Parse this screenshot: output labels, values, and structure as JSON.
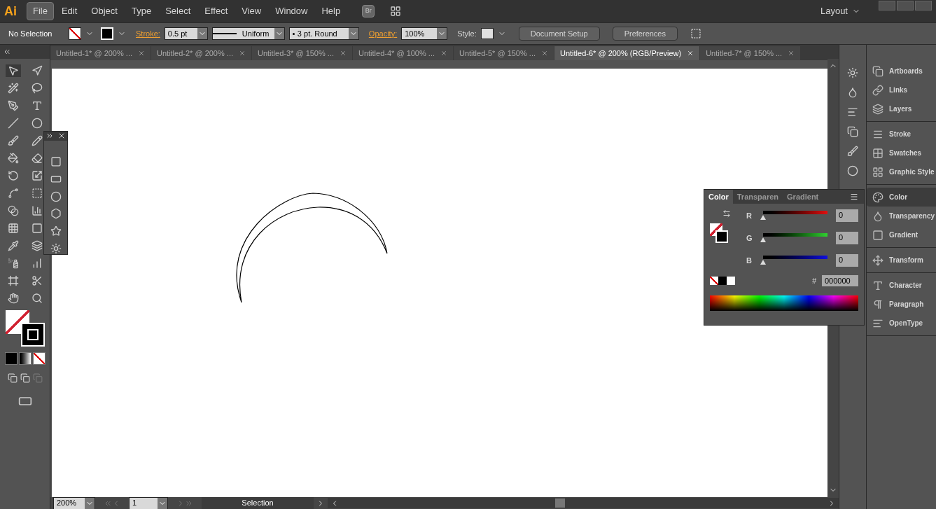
{
  "menu_bar": {
    "logo": "Ai",
    "items": [
      {
        "label": "File",
        "selected": true
      },
      {
        "label": "Edit",
        "selected": false
      },
      {
        "label": "Object",
        "selected": false
      },
      {
        "label": "Type",
        "selected": false
      },
      {
        "label": "Select",
        "selected": false
      },
      {
        "label": "Effect",
        "selected": false
      },
      {
        "label": "View",
        "selected": false
      },
      {
        "label": "Window",
        "selected": false
      },
      {
        "label": "Help",
        "selected": false
      }
    ],
    "bridge": "Br",
    "workspace": "Layout"
  },
  "control_bar": {
    "selection": "No Selection",
    "stroke_label": "Stroke:",
    "stroke_weight": "0.5 pt",
    "profile": "Uniform",
    "brush": "3 pt. Round",
    "opacity_label": "Opacity:",
    "opacity": "100%",
    "style_label": "Style:",
    "buttons": [
      "Document Setup",
      "Preferences"
    ]
  },
  "tabs": [
    {
      "label": "Untitled-1* @ 200% ...",
      "selected": false
    },
    {
      "label": "Untitled-2* @ 200% ...",
      "selected": false
    },
    {
      "label": "Untitled-3* @ 150% ...",
      "selected": false
    },
    {
      "label": "Untitled-4* @ 100% ...",
      "selected": false
    },
    {
      "label": "Untitled-5* @ 150% ...",
      "selected": false
    },
    {
      "label": "Untitled-6* @ 200% (RGB/Preview)",
      "selected": true
    },
    {
      "label": "Untitled-7* @ 150% ...",
      "selected": false
    }
  ],
  "color_panel": {
    "tabs": [
      {
        "label": "Color",
        "selected": true
      },
      {
        "label": "Transparen",
        "selected": false
      },
      {
        "label": "Gradient",
        "selected": false
      }
    ],
    "channels": [
      {
        "label": "R",
        "kind": "red",
        "level": 0,
        "value": "0"
      },
      {
        "label": "G",
        "kind": "green",
        "level": 0,
        "value": "0"
      },
      {
        "label": "B",
        "kind": "blue",
        "level": 0,
        "value": "0"
      }
    ],
    "hex_label": "#",
    "hex": "000000"
  },
  "dock": {
    "groups": [
      [
        {
          "label": "Artboards",
          "selected": false
        },
        {
          "label": "Links",
          "selected": false
        },
        {
          "label": "Layers",
          "selected": false
        }
      ],
      [
        {
          "label": "Stroke",
          "selected": false
        },
        {
          "label": "Swatches",
          "selected": false
        },
        {
          "label": "Graphic Style",
          "selected": false
        }
      ],
      [
        {
          "label": "Color",
          "selected": true
        },
        {
          "label": "Transparency",
          "selected": false
        },
        {
          "label": "Gradient",
          "selected": false
        }
      ],
      [
        {
          "label": "Transform",
          "selected": false
        }
      ],
      [
        {
          "label": "Character",
          "selected": false
        },
        {
          "label": "Paragraph",
          "selected": false
        },
        {
          "label": "OpenType",
          "selected": false
        }
      ]
    ]
  },
  "status_bar": {
    "zoom": "200%",
    "artboard": "1",
    "tool": "Selection"
  }
}
